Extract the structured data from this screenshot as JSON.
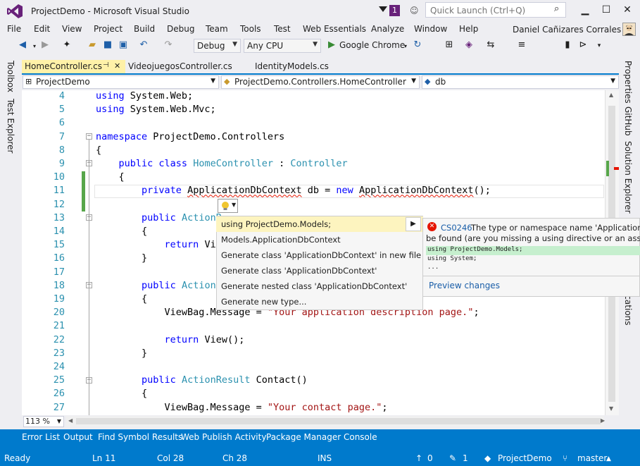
{
  "window": {
    "title": "ProjectDemo - Microsoft Visual Studio",
    "notification_count": "1",
    "quick_launch_placeholder": "Quick Launch (Ctrl+Q)"
  },
  "menu": [
    "File",
    "Edit",
    "View",
    "Project",
    "Build",
    "Debug",
    "Team",
    "Tools",
    "Test",
    "Web Essentials",
    "Analyze",
    "Window",
    "Help"
  ],
  "user": {
    "name": "Daniel Cañizares Corrales"
  },
  "toolbar": {
    "configuration": "Debug",
    "platform": "Any CPU",
    "browser": "Google Chrome"
  },
  "left_panels": [
    "Toolbox",
    "Test Explorer"
  ],
  "right_panels": [
    "Properties",
    "GitHub",
    "Solution Explorer",
    "ications"
  ],
  "tabs": [
    {
      "label": "HomeController.cs",
      "pin": "⊣×",
      "active": true
    },
    {
      "label": "VideojuegosController.cs"
    },
    {
      "label": "IdentityModels.cs"
    }
  ],
  "nav": {
    "project": "ProjectDemo",
    "type": "ProjectDemo.Controllers.HomeController",
    "member": "db"
  },
  "code_lines": [
    {
      "n": "4",
      "html": "<span class=\"kw\">using</span> System.Web;"
    },
    {
      "n": "5",
      "html": "<span class=\"kw\">using</span> System.Web.Mvc;"
    },
    {
      "n": "6",
      "html": ""
    },
    {
      "n": "7",
      "html": "<span class=\"kw\">namespace</span> ProjectDemo.Controllers"
    },
    {
      "n": "8",
      "html": "{"
    },
    {
      "n": "9",
      "html": "    <span class=\"kw\">public class</span> <span class=\"ty\">HomeController</span> : <span class=\"ty\">Controller</span>"
    },
    {
      "n": "10",
      "html": "    {"
    },
    {
      "n": "11",
      "html": "        <span class=\"kw\">private</span> <span class=\"squig\">ApplicationDbContext</span> db = <span class=\"kw\">new</span> <span class=\"squig\">ApplicationDbContext</span>();"
    },
    {
      "n": "12",
      "html": ""
    },
    {
      "n": "13",
      "html": "        <span class=\"kw\">public</span> <span class=\"ty\">ActionR</span>"
    },
    {
      "n": "14",
      "html": "        {"
    },
    {
      "n": "15",
      "html": "            <span class=\"kw\">return</span> Vie"
    },
    {
      "n": "16",
      "html": "        }"
    },
    {
      "n": "17",
      "html": ""
    },
    {
      "n": "18",
      "html": "        <span class=\"kw\">public</span> <span class=\"ty\">ActionR</span>"
    },
    {
      "n": "19",
      "html": "        {"
    },
    {
      "n": "20",
      "html": "            ViewBag.Message = <span class=\"st\">\"Your application description page.\"</span>;"
    },
    {
      "n": "21",
      "html": ""
    },
    {
      "n": "22",
      "html": "            <span class=\"kw\">return</span> View();"
    },
    {
      "n": "23",
      "html": "        }"
    },
    {
      "n": "24",
      "html": ""
    },
    {
      "n": "25",
      "html": "        <span class=\"kw\">public</span> <span class=\"ty\">ActionResult</span> Contact()"
    },
    {
      "n": "26",
      "html": "        {"
    },
    {
      "n": "27",
      "html": "            ViewBag.Message = <span class=\"st\">\"Your contact page.\"</span>;"
    }
  ],
  "quick_actions": [
    "using ProjectDemo.Models;",
    "Models.ApplicationDbContext",
    "Generate class 'ApplicationDbContext' in new file",
    "Generate class 'ApplicationDbContext'",
    "Generate nested class 'ApplicationDbContext'",
    "Generate new type..."
  ],
  "preview": {
    "error_code": "CS0246",
    "message_line1": "The type or namespace name 'ApplicationDbC",
    "message_line2": "be found (are you missing a using directive or an assembl",
    "diff_added": "using ProjectDemo.Models;",
    "diff_context": "using System;",
    "diff_more": "...",
    "link": "Preview changes"
  },
  "zoom": "113 %",
  "bottom_tabs": [
    "Error List",
    "Output",
    "Find Symbol Results",
    "Web Publish Activity",
    "Package Manager Console"
  ],
  "status": {
    "state": "Ready",
    "line": "Ln 11",
    "col": "Col 28",
    "ch": "Ch 28",
    "mode": "INS",
    "up": "0",
    "pencil": "1",
    "repo": "ProjectDemo",
    "branch": "master"
  }
}
